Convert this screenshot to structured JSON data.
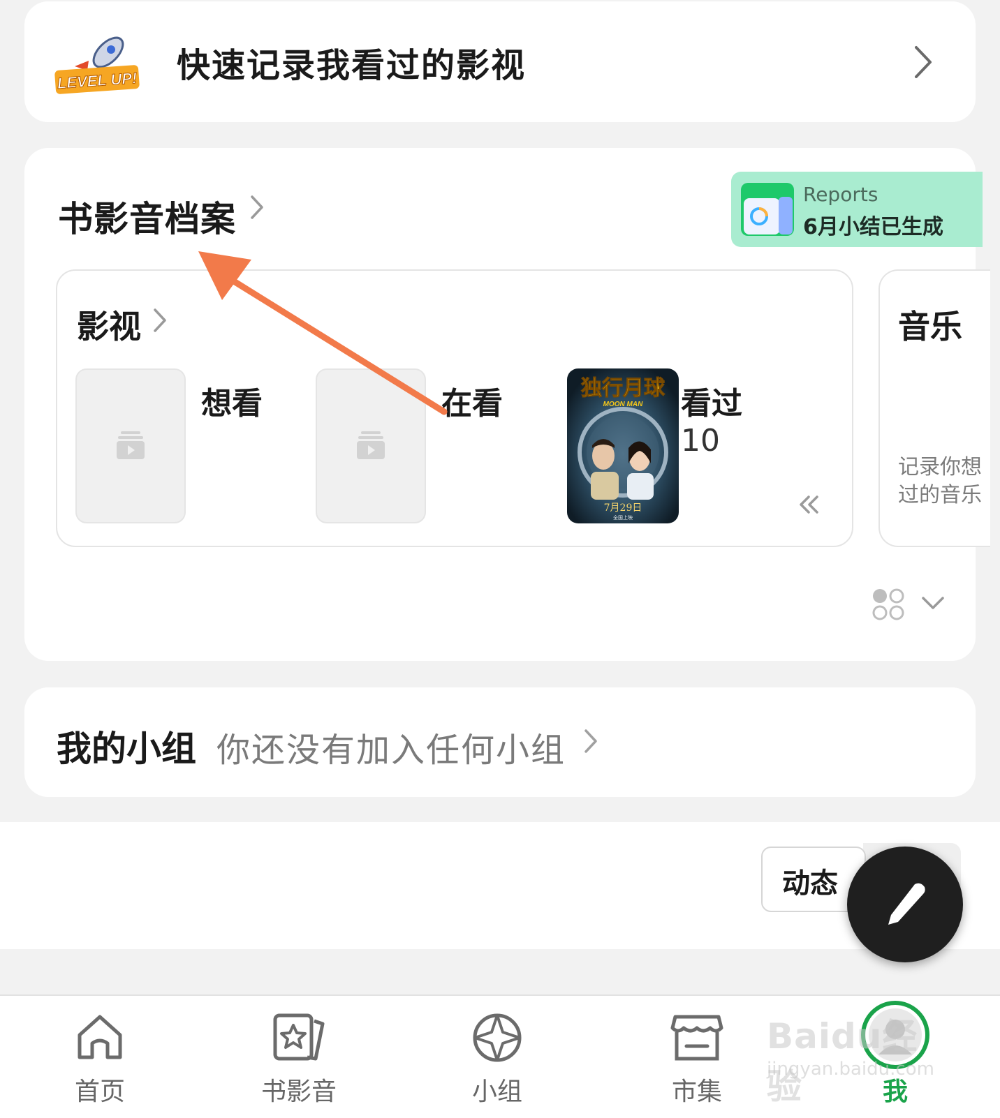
{
  "quick_record": {
    "logo_text": "LEVEL UP!",
    "title": "快速记录我看过的影视"
  },
  "archive": {
    "title": "书影音档案",
    "reports": {
      "label": "Reports",
      "text": "6月小结已生成"
    },
    "movies": {
      "title": "影视",
      "slots": [
        {
          "label": "想看"
        },
        {
          "label": "在看"
        },
        {
          "label": "看过",
          "count": "10"
        }
      ],
      "poster": {
        "title": "独行月球",
        "subtitle": "MOON MAN",
        "date": "7月29日",
        "tagline": "全国上映"
      }
    },
    "music": {
      "title": "音乐",
      "desc_line1": "记录你想",
      "desc_line2": "过的音乐"
    }
  },
  "groups": {
    "title": "我的小组",
    "empty_text": "你还没有加入任何小组"
  },
  "feed": {
    "tab_label": "动态"
  },
  "nav": {
    "items": [
      {
        "label": "首页",
        "icon": "home-icon"
      },
      {
        "label": "书影音",
        "icon": "star-cards-icon"
      },
      {
        "label": "小组",
        "icon": "group-globe-icon"
      },
      {
        "label": "市集",
        "icon": "shop-icon"
      },
      {
        "label": "我",
        "icon": "avatar-icon"
      }
    ],
    "active": "我"
  },
  "watermark": {
    "line1": "Baidu经验",
    "line2": "jingyan.baidu.com"
  },
  "colors": {
    "accent_green": "#1aa34a",
    "reports_bg": "#a9ecd0",
    "arrow": "#f27a4a",
    "fab": "#1f1f1f"
  }
}
